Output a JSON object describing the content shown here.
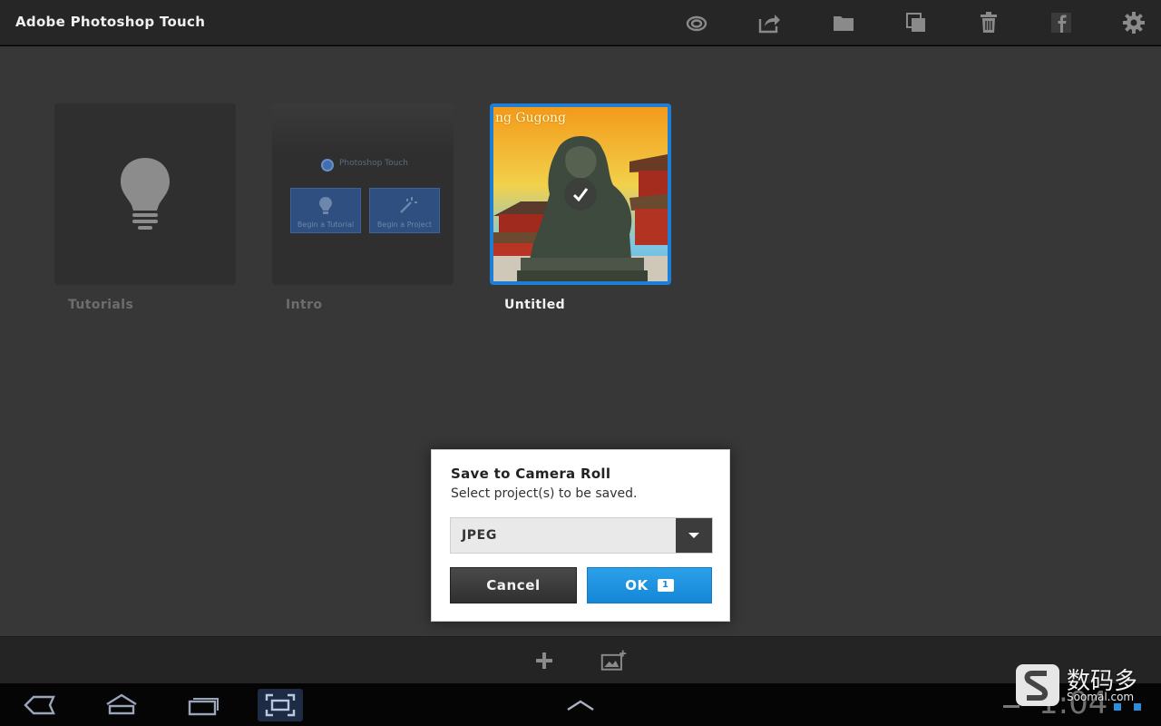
{
  "app": {
    "title": "Adobe Photoshop Touch"
  },
  "toolbar": {
    "icons": [
      "creative-cloud-icon",
      "share-icon",
      "folder-icon",
      "duplicate-icon",
      "trash-icon",
      "facebook-icon",
      "gear-icon"
    ]
  },
  "projects": [
    {
      "name": "Tutorials",
      "selected": false
    },
    {
      "name": "Intro",
      "selected": false,
      "thumbnail": {
        "brand": "Photoshop Touch",
        "button_1": "Begin a Tutorial",
        "button_2": "Begin a Project"
      }
    },
    {
      "name": "Untitled",
      "selected": true,
      "thumbnail_caption": "ng Gugong"
    }
  ],
  "bottom_toolbar": {
    "icons": [
      "add-icon",
      "add-image-icon"
    ]
  },
  "dialog": {
    "title": "Save to Camera Roll",
    "subtitle": "Select project(s) to be saved.",
    "format": {
      "selected": "JPEG"
    },
    "cancel_label": "Cancel",
    "ok_label": "OK",
    "ok_count": "1"
  },
  "status_bar": {
    "clock": "1:04"
  },
  "watermark": {
    "site_cn": "数码多",
    "url": "Soomal.com"
  },
  "colors": {
    "accent": "#1e7ed6",
    "ok_button": "#1586d6",
    "background": "#373737"
  }
}
